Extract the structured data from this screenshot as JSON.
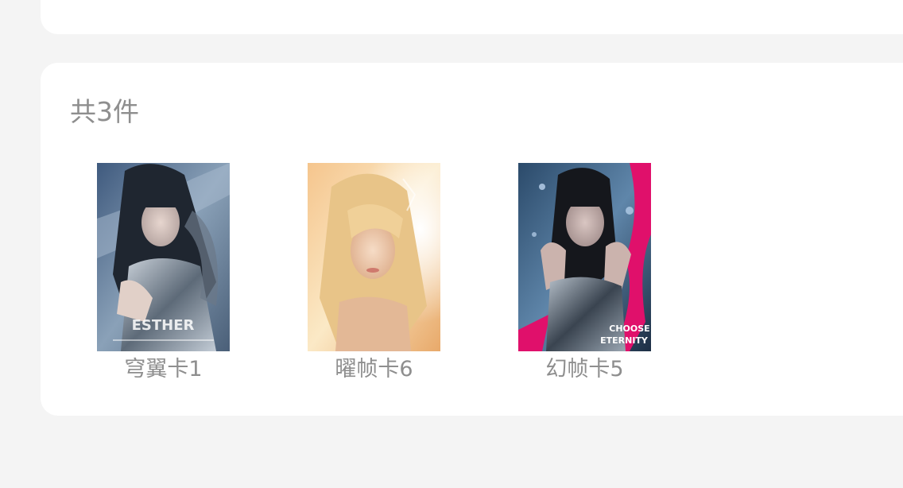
{
  "summary": {
    "count_text": "共3件"
  },
  "items": [
    {
      "name": "穹翼卡1",
      "image": {
        "subject": "card-art-esther",
        "overlay_text": "ESTHER"
      }
    },
    {
      "name": "曜帧卡6",
      "image": {
        "subject": "card-art-blonde"
      }
    },
    {
      "name": "幻帧卡5",
      "image": {
        "subject": "card-art-choose-eternity",
        "overlay_text_1": "CHOOSE",
        "overlay_text_2": "ETERNITY"
      }
    }
  ],
  "colors": {
    "background": "#f4f4f4",
    "card": "#ffffff",
    "text_muted": "#8e8e8e",
    "accent_pink": "#e0106b"
  }
}
